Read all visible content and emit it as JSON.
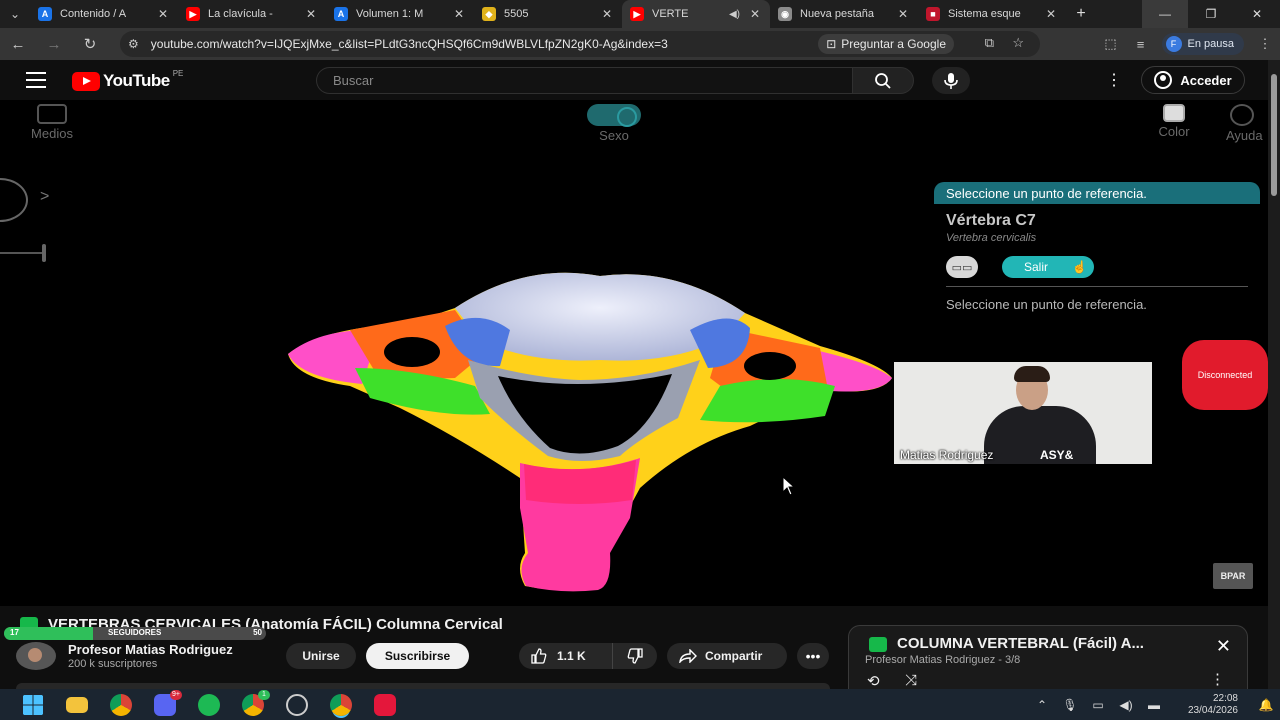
{
  "browser": {
    "tabs": [
      {
        "title": "Contenido / A",
        "favicon": "A",
        "color": "#1a73e8"
      },
      {
        "title": "La clavícula -",
        "favicon": "▶",
        "color": "#ff0000"
      },
      {
        "title": "Volumen 1: M",
        "favicon": "A",
        "color": "#1a73e8"
      },
      {
        "title": "5505",
        "favicon": "◆",
        "color": "#e0b21b"
      },
      {
        "title": "VERTE",
        "favicon": "▶",
        "color": "#ff0000",
        "active": true
      },
      {
        "title": "Nueva pestaña",
        "favicon": "◉",
        "color": "#8a8a8a"
      },
      {
        "title": "Sistema esque",
        "favicon": "■",
        "color": "#c0162c"
      }
    ],
    "url": "youtube.com/watch?v=IJQExjMxe_c&list=PLdtG3ncQHSQf6Cm9dWBLVLfpZN2gK0-Ag&index=3",
    "ask_google": "Preguntar a Google",
    "profile_status": "En pausa",
    "profile_initial": "F"
  },
  "youtube": {
    "logo": "YouTube",
    "region": "PE",
    "search_placeholder": "Buscar",
    "signin_label": "Acceder"
  },
  "video": {
    "top_controls": [
      "Medios",
      "Sexo",
      "Color",
      "Ayuda"
    ],
    "panel": {
      "header": "Seleccione un punto de referencia.",
      "title": "Vértebra C7",
      "subtitle": "Vertebra cervicalis",
      "exit_label": "Salir",
      "hint": "Seleccione un punto de referencia."
    },
    "webcam_name": "Matias Rodriguez",
    "webcam_brand": "ASY&",
    "overlay_status": "Disconnected",
    "watermark": "BPAR"
  },
  "below": {
    "title": "VERTEBRAS CERVICALES (Anatomía FÁCIL) Columna Cervical",
    "followers_label": "SEGUIDORES",
    "followers_current": "17",
    "followers_goal": "50",
    "followers_progress": 0.34,
    "channel_name": "Profesor Matias Rodriguez",
    "subscribers": "200 k suscriptores",
    "join_label": "Unirse",
    "subscribe_label": "Suscribirse",
    "likes": "1.1 K",
    "share_label": "Compartir"
  },
  "playlist": {
    "title": "COLUMNA VERTEBRAL (Fácil) A...",
    "subtitle": "Profesor Matias Rodriguez - 3/8"
  },
  "taskbar": {
    "time": "22:08",
    "date": "23/04/2026",
    "discord_badge": "9+",
    "chrome2_badge": "1"
  },
  "colors": {
    "yt_red": "#ff0000",
    "teal": "#1a6f7a",
    "follower_green": "#2fbf5a"
  }
}
